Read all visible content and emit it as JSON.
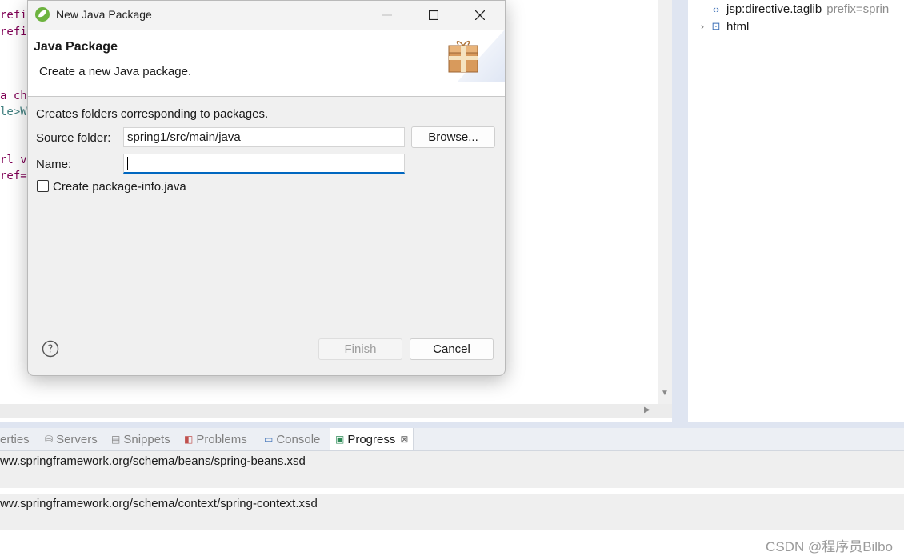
{
  "editor": {
    "lines": [
      {
        "text": "refi",
        "cls": "kw"
      },
      {
        "text": "refi",
        "cls": "kw"
      },
      {
        "text": "a ch",
        "cls": "kw"
      },
      {
        "text": "le>W",
        "cls": "tag"
      },
      {
        "text": "rl v",
        "cls": "kw"
      },
      {
        "text": "ref=",
        "cls": "kw"
      }
    ]
  },
  "outline": {
    "items": [
      {
        "label": "jsp:directive.taglib",
        "suffix": "prefix=sprin",
        "icon": "tag-icon"
      },
      {
        "label": "html",
        "suffix": "",
        "icon": "html-element-icon"
      }
    ]
  },
  "views": {
    "tabs": [
      {
        "label": "erties",
        "icon": "properties-icon"
      },
      {
        "label": "Servers",
        "icon": "servers-icon"
      },
      {
        "label": "Snippets",
        "icon": "snippets-icon"
      },
      {
        "label": "Problems",
        "icon": "problems-icon"
      },
      {
        "label": "Console",
        "icon": "console-icon"
      },
      {
        "label": "Progress",
        "icon": "progress-icon"
      }
    ],
    "active_tab": "Progress"
  },
  "progress": {
    "rows": [
      "ww.springframework.org/schema/beans/spring-beans.xsd",
      "ww.springframework.org/schema/context/spring-context.xsd"
    ]
  },
  "watermark": "CSDN @程序员Bilbo",
  "dialog": {
    "title": "New Java Package",
    "header_title": "Java Package",
    "header_desc": "Create a new Java package.",
    "body_desc": "Creates folders corresponding to packages.",
    "source_label": "Source folder:",
    "source_value": "spring1/src/main/java",
    "browse_label": "Browse...",
    "name_label": "Name:",
    "name_value": "",
    "checkbox_label": "Create package-info.java",
    "checkbox_checked": false,
    "finish_label": "Finish",
    "cancel_label": "Cancel"
  },
  "colors": {
    "accent": "#0067c0",
    "banner_bg": "#ffffff",
    "dialog_bg": "#f0f0f0",
    "keyword": "#7f0055"
  }
}
